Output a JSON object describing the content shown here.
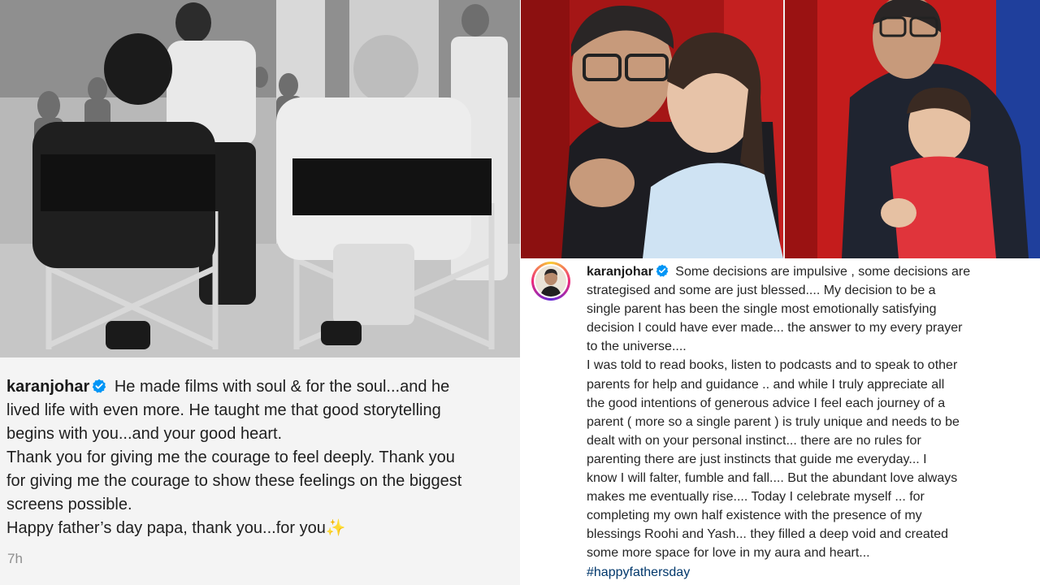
{
  "left_post": {
    "username": "karanjohar",
    "caption_lines": [
      "He made films with soul & for the soul...and he",
      "lived life with even more. He taught me that good storytelling",
      "begins with you...and your good heart.",
      "Thank you for giving me the courage to feel deeply. Thank you",
      "for giving me the courage to show these feelings on the biggest",
      "screens possible.",
      "Happy father’s day papa, thank you...for you"
    ],
    "emoji": "✨",
    "timestamp": "7h"
  },
  "right_post": {
    "username": "karanjohar",
    "caption_first": "Some decisions are impulsive , some decisions are",
    "caption_lines": [
      "strategised and some are just blessed.... My decision to be a",
      "single parent has been the single most emotionally satisfying",
      "decision I could have ever made... the answer to my every prayer",
      "to the universe....",
      "I was told to read books, listen to podcasts and to speak to other",
      "parents for help and guidance .. and while I truly appreciate all",
      "the good intentions of generous advice I feel each journey of a",
      "parent ( more so a single parent ) is truly unique and needs to be",
      "dealt with on your personal instinct... there are no rules for",
      "parenting there are just instincts that guide me everyday... I",
      "know I will falter, fumble and fall.... But the abundant love always",
      "makes me eventually rise.... Today I celebrate myself ... for",
      "completing my own half existence with the presence of my",
      "blessings Roohi and Yash... they filled a deep void and created",
      "some more space for love in my aura and heart..."
    ],
    "hashtag": "#happyfathersday"
  },
  "icons": {
    "verified": "verified-badge-icon",
    "avatar": "profile-avatar"
  },
  "colors": {
    "verified_blue": "#0095f6",
    "hashtag_blue": "#00376b",
    "timestamp_gray": "#8e8e8e",
    "curtain_red": "#c81e1e"
  }
}
